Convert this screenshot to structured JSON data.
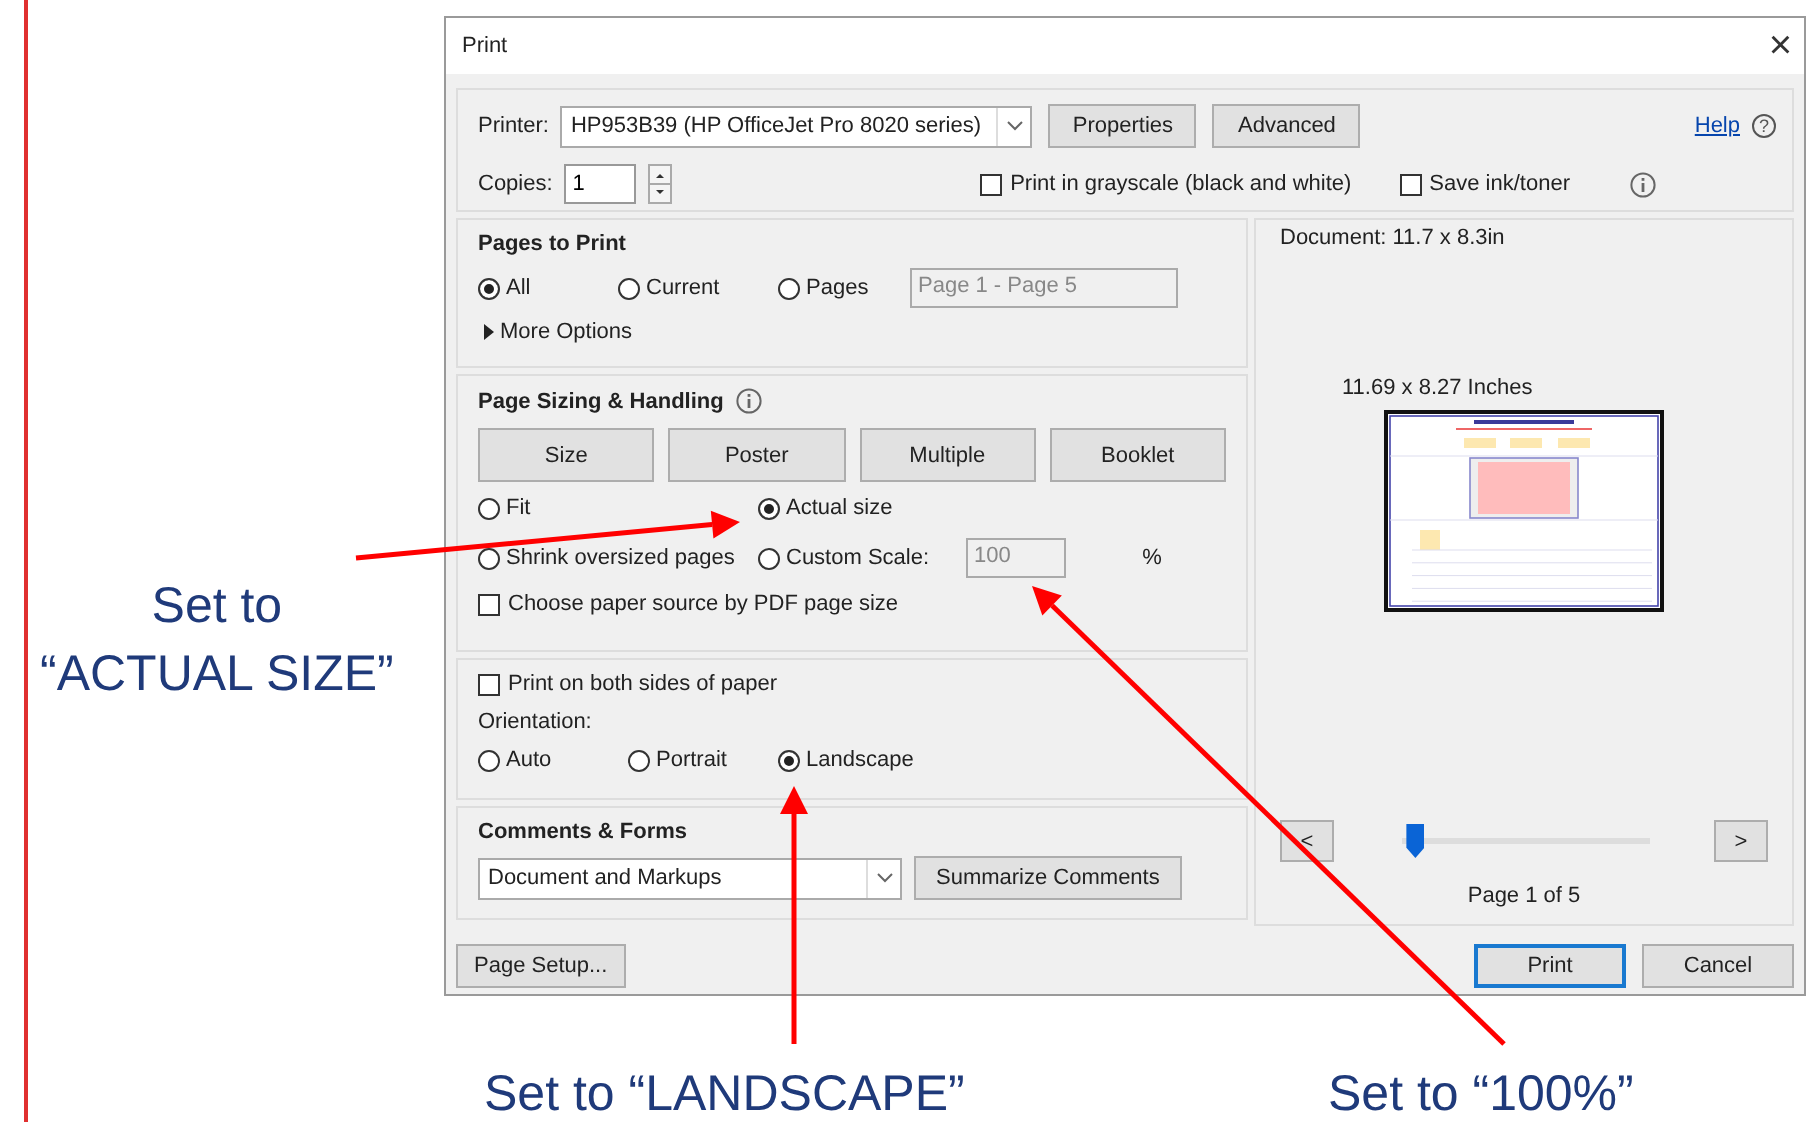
{
  "window": {
    "title": "Print",
    "close": "×"
  },
  "printer": {
    "label": "Printer:",
    "value": "HP953B39 (HP OfficeJet Pro 8020 series)",
    "buttons": [
      "Properties",
      "Advanced"
    ],
    "help": "Help",
    "help_icon": "?"
  },
  "copies": {
    "label": "Copies:",
    "value": "1"
  },
  "options": [
    {
      "label": "Print in grayscale (black and white)",
      "checked": false
    },
    {
      "label": "Save ink/toner",
      "checked": false
    }
  ],
  "pages_to_print": {
    "title": "Pages to Print",
    "choices": [
      {
        "label": "All",
        "selected": true
      },
      {
        "label": "Current",
        "selected": false
      },
      {
        "label": "Pages",
        "selected": false
      }
    ],
    "range": {
      "value": "Page 1 - Page 5",
      "disabled": true
    },
    "more_options": {
      "label": "More Options",
      "expanded": false
    }
  },
  "page_sizing": {
    "title": "Page Sizing & Handling",
    "modes": [
      "Size",
      "Poster",
      "Multiple",
      "Booklet"
    ],
    "scaling": [
      {
        "label": "Fit",
        "selected": false
      },
      {
        "label": "Actual size",
        "selected": true
      },
      {
        "label": "Shrink oversized pages",
        "selected": false
      },
      {
        "label": "Custom Scale:",
        "selected": false
      }
    ],
    "custom_scale": {
      "value": "100",
      "unit": "%",
      "disabled": true
    },
    "paper_source": {
      "label": "Choose paper source by PDF page size",
      "checked": false
    }
  },
  "duplex": {
    "label": "Print on both sides of paper",
    "checked": false
  },
  "orientation": {
    "title": "Orientation:",
    "choices": [
      {
        "label": "Auto",
        "selected": false
      },
      {
        "label": "Portrait",
        "selected": false
      },
      {
        "label": "Landscape",
        "selected": true
      }
    ]
  },
  "comments_forms": {
    "title": "Comments & Forms",
    "value": "Document and Markups",
    "button": "Summarize Comments"
  },
  "preview": {
    "document_size": "Document: 11.7 x 8.3in",
    "page_size": "11.69 x 8.27 Inches",
    "prev": "<",
    "next": ">",
    "slider": {
      "level": 0.05
    },
    "page_label": "Page 1 of 5"
  },
  "footer": {
    "page_setup": "Page Setup...",
    "print": "Print",
    "cancel": "Cancel"
  },
  "annotations": [
    {
      "lines": [
        "Set to",
        "“ACTUAL SIZE”"
      ]
    },
    {
      "lines": [
        "Set to “LANDSCAPE”"
      ]
    },
    {
      "lines": [
        "Set to “100%”"
      ]
    }
  ]
}
